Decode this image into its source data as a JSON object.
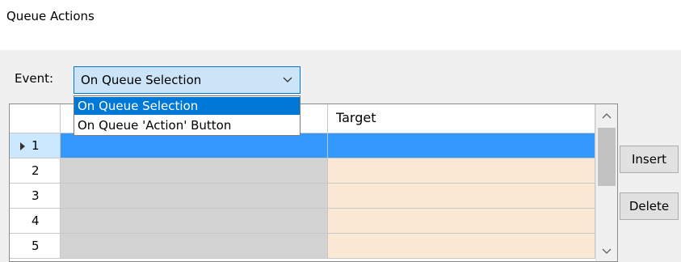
{
  "window": {
    "title": "Queue Actions"
  },
  "event": {
    "label": "Event:",
    "selected": "On Queue Selection",
    "options": [
      "On Queue Selection",
      "On Queue 'Action' Button"
    ]
  },
  "grid": {
    "columns": [
      "Target"
    ],
    "current_row": 1,
    "rows": [
      "1",
      "2",
      "3",
      "4",
      "5"
    ]
  },
  "buttons": {
    "insert": "Insert",
    "delete": "Delete"
  },
  "colors": {
    "combo_bg": "#cce4f7",
    "selection": "#3399ff",
    "highlight": "#0078d7",
    "col_a_bg": "#d3d3d3",
    "col_b_bg": "#fae8d5"
  }
}
